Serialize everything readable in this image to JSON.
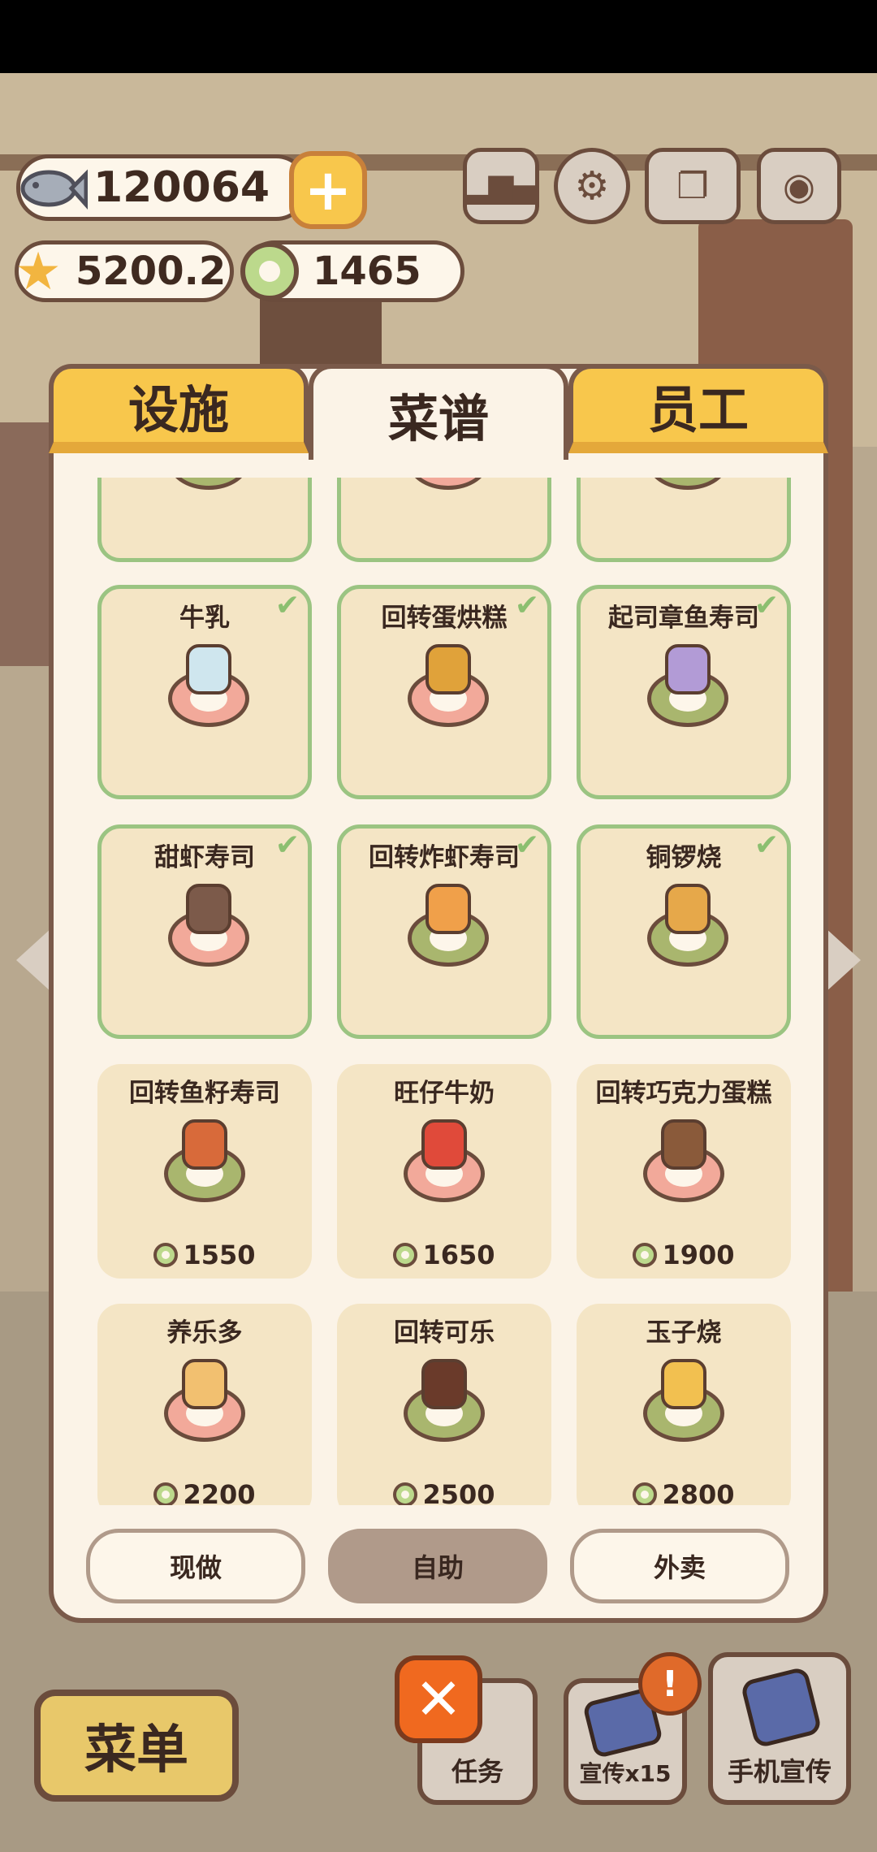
{
  "hud": {
    "fish": "120064",
    "stars": "5200.2",
    "coins": "1465",
    "icons": [
      "fish-icon",
      "plus-icon",
      "ranking-icon",
      "gear-icon",
      "recipe-book-icon",
      "camera-icon",
      "star-icon",
      "coin-icon"
    ]
  },
  "tabs": [
    {
      "label": "设施",
      "active": false
    },
    {
      "label": "菜谱",
      "active": true
    },
    {
      "label": "员工",
      "active": false
    }
  ],
  "recipes": [
    {
      "name": "",
      "owned": true,
      "plate": "green",
      "price": ""
    },
    {
      "name": "",
      "owned": true,
      "plate": "pink",
      "price": ""
    },
    {
      "name": "",
      "owned": true,
      "plate": "green",
      "price": ""
    },
    {
      "name": "牛乳",
      "owned": true,
      "plate": "pink",
      "food": "#cfe6ee",
      "price": ""
    },
    {
      "name": "回转蛋烘糕",
      "owned": true,
      "plate": "pink",
      "food": "#e0a23a",
      "price": ""
    },
    {
      "name": "起司章鱼寿司",
      "owned": true,
      "plate": "green",
      "food": "#b29bd6",
      "price": ""
    },
    {
      "name": "甜虾寿司",
      "owned": true,
      "plate": "pink",
      "food": "#7c5a4a",
      "price": ""
    },
    {
      "name": "回转炸虾寿司",
      "owned": true,
      "plate": "green",
      "food": "#f0a04a",
      "price": ""
    },
    {
      "name": "铜锣烧",
      "owned": true,
      "plate": "green",
      "food": "#e6a84a",
      "price": ""
    },
    {
      "name": "回转鱼籽寿司",
      "owned": false,
      "plate": "green",
      "food": "#d86a3a",
      "price": "1550"
    },
    {
      "name": "旺仔牛奶",
      "owned": false,
      "plate": "pink",
      "food": "#e04a3a",
      "price": "1650"
    },
    {
      "name": "回转巧克力蛋糕",
      "owned": false,
      "plate": "pink",
      "food": "#8a5a3a",
      "price": "1900"
    },
    {
      "name": "养乐多",
      "owned": false,
      "plate": "pink",
      "food": "#f2c070",
      "price": "2200"
    },
    {
      "name": "回转可乐",
      "owned": false,
      "plate": "green",
      "food": "#6a3a2a",
      "price": "2500"
    },
    {
      "name": "玉子烧",
      "owned": false,
      "plate": "green",
      "food": "#f2c050",
      "price": "2800"
    }
  ],
  "filters": [
    {
      "label": "现做",
      "selected": false
    },
    {
      "label": "自助",
      "selected": true
    },
    {
      "label": "外卖",
      "selected": false
    }
  ],
  "bottom": {
    "menu": "菜单",
    "tasks": "任务",
    "promo": "宣传x15",
    "phone_promo": "手机宣传"
  },
  "colors": {
    "accent": "#f8c74c",
    "owned_border": "#9bc482",
    "close": "#f0691f"
  }
}
